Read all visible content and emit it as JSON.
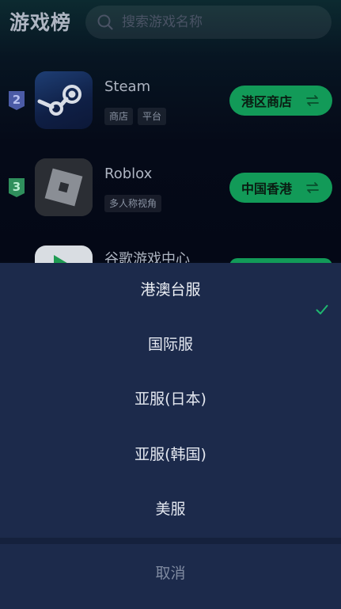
{
  "header": {
    "title": "游戏榜",
    "search_placeholder": "搜索游戏名称"
  },
  "games": [
    {
      "rank": "2",
      "rank_color": "#4b5ba6",
      "name": "Steam",
      "tags": [
        "商店",
        "平台"
      ],
      "region_label": "港区商店",
      "icon": "steam-logo-icon"
    },
    {
      "rank": "3",
      "rank_color": "#2f8f5c",
      "name": "Roblox",
      "tags": [
        "多人称视角"
      ],
      "region_label": "中国香港",
      "icon": "roblox-logo-icon"
    },
    {
      "name": "谷歌游戏中心",
      "icon": "google-play-games-icon"
    }
  ],
  "colors": {
    "accent": "#129a58",
    "sheet_bg": "#1c2a4b",
    "check": "#1fb870"
  },
  "region_sheet": {
    "options": [
      {
        "label": "港澳台服",
        "selected": true
      },
      {
        "label": "国际服",
        "selected": false
      },
      {
        "label": "亚服(日本)",
        "selected": false
      },
      {
        "label": "亚服(韩国)",
        "selected": false
      },
      {
        "label": "美服",
        "selected": false
      }
    ],
    "cancel_label": "取消"
  }
}
